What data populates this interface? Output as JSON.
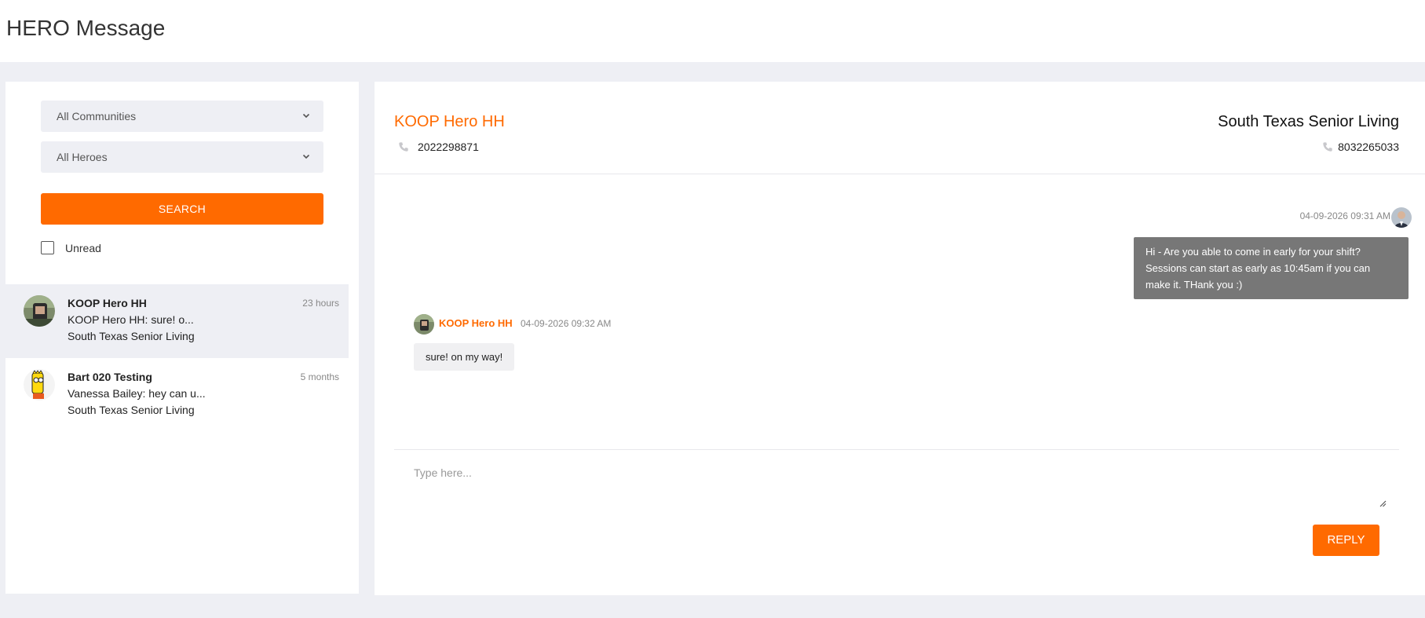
{
  "page": {
    "title": "HERO Message"
  },
  "filters": {
    "community_select": "All Communities",
    "hero_select": "All Heroes",
    "search_label": "SEARCH",
    "unread_label": "Unread",
    "unread_checked": false
  },
  "conversations": [
    {
      "name": "KOOP Hero HH",
      "time": "23 hours",
      "preview": "KOOP Hero HH: sure! o...",
      "community": "South Texas Senior Living",
      "active": true
    },
    {
      "name": "Bart 020 Testing",
      "time": "5 months",
      "preview": "Vanessa Bailey: hey can u...",
      "community": "South Texas Senior Living",
      "active": false
    }
  ],
  "chat": {
    "hero_name": "KOOP Hero HH",
    "hero_phone": "2022298871",
    "community_name": "South Texas Senior Living",
    "community_phone": "8032265033",
    "messages": [
      {
        "direction": "outgoing",
        "timestamp": "04-09-2026 09:31 AM",
        "text": "Hi - Are you able to come in early for your shift? Sessions can start as early as 10:45am if you can make it. THank you :)"
      },
      {
        "direction": "incoming",
        "sender": "KOOP Hero HH",
        "timestamp": "04-09-2026 09:32 AM",
        "text": "sure! on my way!"
      }
    ],
    "composer_placeholder": "Type here...",
    "reply_label": "REPLY"
  },
  "colors": {
    "accent": "#ff6a00",
    "background": "#eeeff4",
    "outgoing_bubble": "#777777",
    "incoming_bubble": "#f0f0f2"
  },
  "icons": [
    "chevron-down-icon",
    "phone-icon",
    "resize-handle-icon"
  ]
}
